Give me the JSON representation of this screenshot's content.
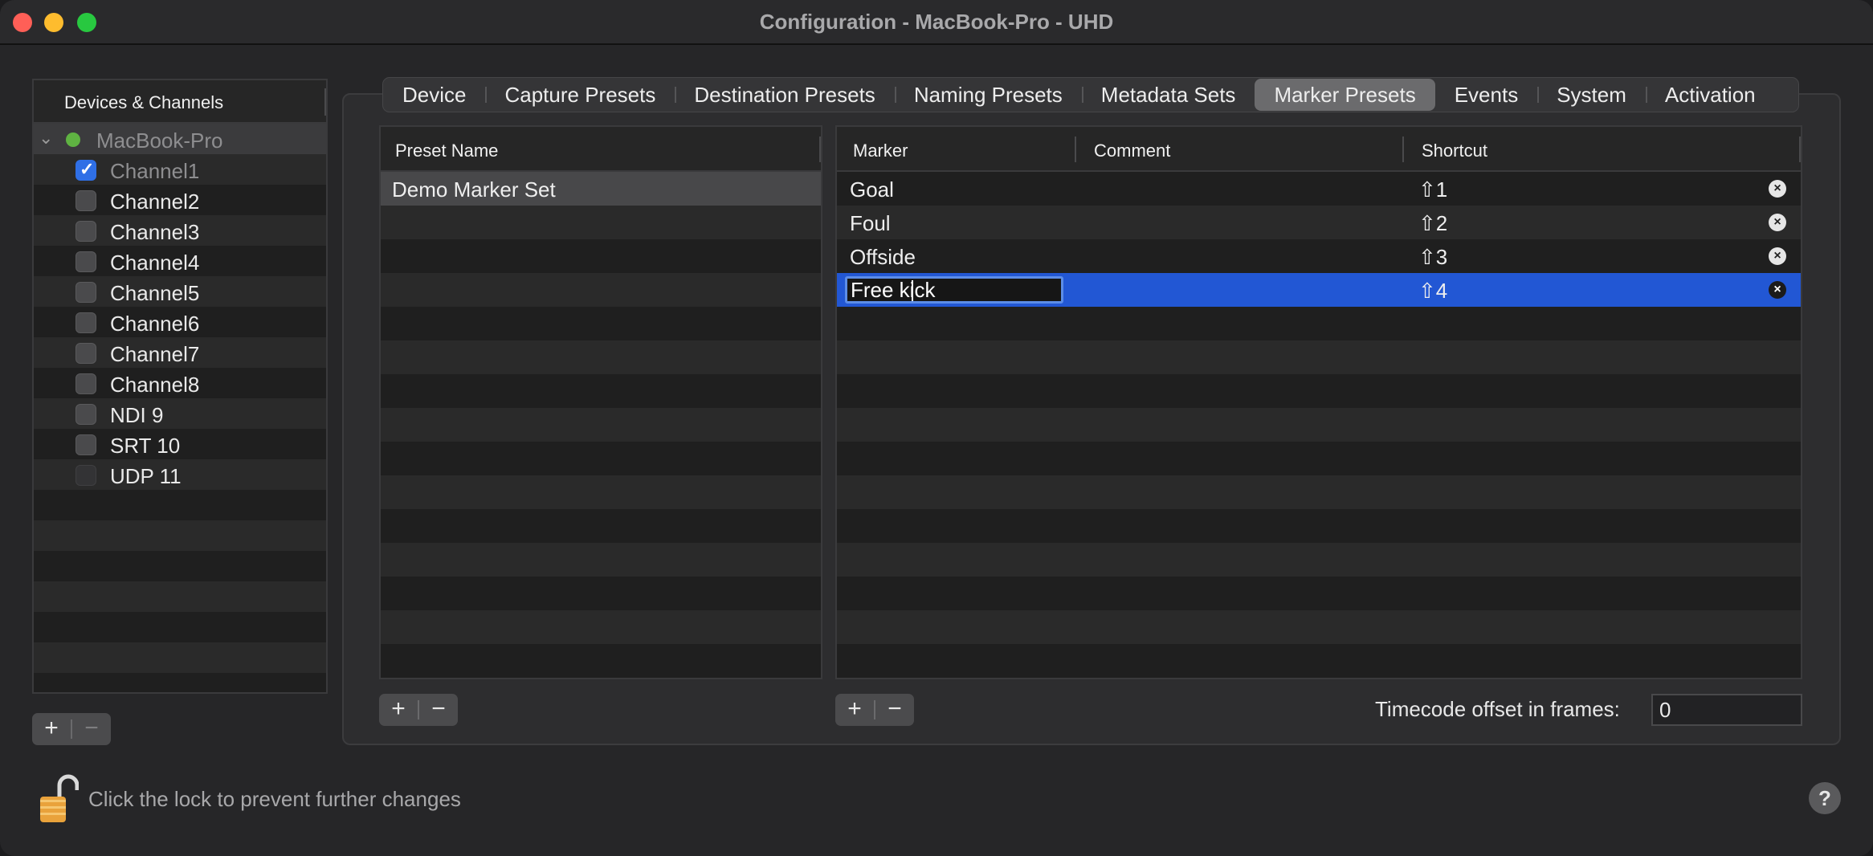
{
  "window": {
    "title": "Configuration - MacBook-Pro - UHD"
  },
  "devices": {
    "header": "Devices & Channels",
    "device": {
      "name": "MacBook-Pro",
      "status_color": "#5fb342"
    },
    "channels": [
      {
        "name": "Channel1",
        "checked": true,
        "enabled": false
      },
      {
        "name": "Channel2",
        "checked": false,
        "enabled": true
      },
      {
        "name": "Channel3",
        "checked": false,
        "enabled": true
      },
      {
        "name": "Channel4",
        "checked": false,
        "enabled": true
      },
      {
        "name": "Channel5",
        "checked": false,
        "enabled": true
      },
      {
        "name": "Channel6",
        "checked": false,
        "enabled": true
      },
      {
        "name": "Channel7",
        "checked": false,
        "enabled": true
      },
      {
        "name": "Channel8",
        "checked": false,
        "enabled": true
      },
      {
        "name": "NDI 9",
        "checked": false,
        "enabled": true
      },
      {
        "name": "SRT 10",
        "checked": false,
        "enabled": true
      },
      {
        "name": "UDP 11",
        "checked": false,
        "enabled": false
      }
    ],
    "add_label": "+",
    "remove_label": "−"
  },
  "tabs": [
    {
      "label": "Device",
      "active": false
    },
    {
      "label": "Capture Presets",
      "active": false
    },
    {
      "label": "Destination Presets",
      "active": false
    },
    {
      "label": "Naming Presets",
      "active": false
    },
    {
      "label": "Metadata Sets",
      "active": false
    },
    {
      "label": "Marker Presets",
      "active": true
    },
    {
      "label": "Events",
      "active": false
    },
    {
      "label": "System",
      "active": false
    },
    {
      "label": "Activation",
      "active": false
    }
  ],
  "presets": {
    "header": "Preset Name",
    "items": [
      "Demo Marker Set"
    ],
    "add_label": "+",
    "remove_label": "−"
  },
  "markers": {
    "headers": {
      "marker": "Marker",
      "comment": "Comment",
      "shortcut": "Shortcut"
    },
    "rows": [
      {
        "marker": "Goal",
        "comment": "",
        "shortcut": "⇧1"
      },
      {
        "marker": "Foul",
        "comment": "",
        "shortcut": "⇧2"
      },
      {
        "marker": "Offside",
        "comment": "",
        "shortcut": "⇧3"
      },
      {
        "marker": "Free kick",
        "comment": "",
        "shortcut": "⇧4",
        "editing": true
      }
    ],
    "delete_label": "×",
    "add_label": "+",
    "remove_label": "−"
  },
  "timecode": {
    "label": "Timecode offset in frames:",
    "value": "0"
  },
  "footer": {
    "lock_text": "Click the lock to prevent further changes",
    "help_label": "?"
  },
  "colors": {
    "accent": "#2257d4",
    "checkbox": "#2f6fe6",
    "close": "#ff5f57",
    "minimize": "#febc2e",
    "maximize": "#28c840"
  }
}
